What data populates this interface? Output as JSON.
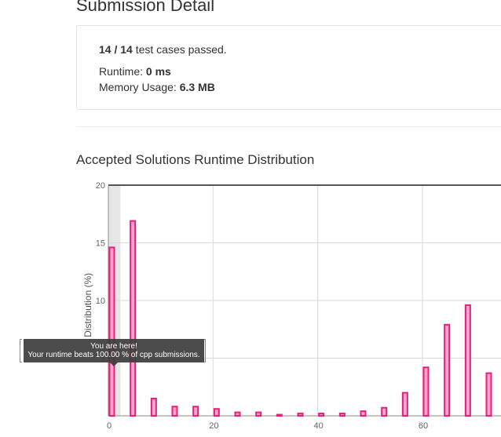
{
  "page": {
    "title": "Submission Detail"
  },
  "result": {
    "cases_passed": "14 / 14",
    "cases_suffix": " test cases passed.",
    "runtime_label": "Runtime: ",
    "runtime_value": "0 ms",
    "memory_label": "Memory Usage: ",
    "memory_value": "6.3 MB"
  },
  "distribution": {
    "title": "Accepted Solutions Runtime Distribution",
    "tooltip_title": "You are here!",
    "tooltip_text": "Your runtime beats 100.00 % of cpp submissions."
  },
  "colors": {
    "bar_fill": "#ffa3cf",
    "bar_stroke": "#e91e79",
    "highlight_band": "#e6e6e6",
    "grid": "#d9d9d9"
  },
  "chart_data": {
    "type": "bar",
    "xlabel": "",
    "ylabel": "Distribution (%)",
    "xlim": [
      0,
      75
    ],
    "ylim": [
      0,
      20
    ],
    "x_ticks": [
      "0",
      "20",
      "40",
      "60"
    ],
    "y_ticks": [
      "5",
      "10",
      "15",
      "20"
    ],
    "highlight_x": [
      0,
      2
    ],
    "grid": true,
    "series": [
      {
        "x": [
          0,
          4,
          8,
          12,
          16,
          20,
          24,
          28,
          32,
          36,
          40,
          44,
          48,
          52,
          56,
          60,
          64,
          68,
          72
        ],
        "values": [
          14.6,
          16.9,
          1.5,
          0.8,
          0.8,
          0.6,
          0.3,
          0.3,
          0.1,
          0.2,
          0.2,
          0.2,
          0.4,
          0.7,
          2.0,
          4.2,
          7.9,
          9.6,
          3.7
        ]
      }
    ]
  }
}
